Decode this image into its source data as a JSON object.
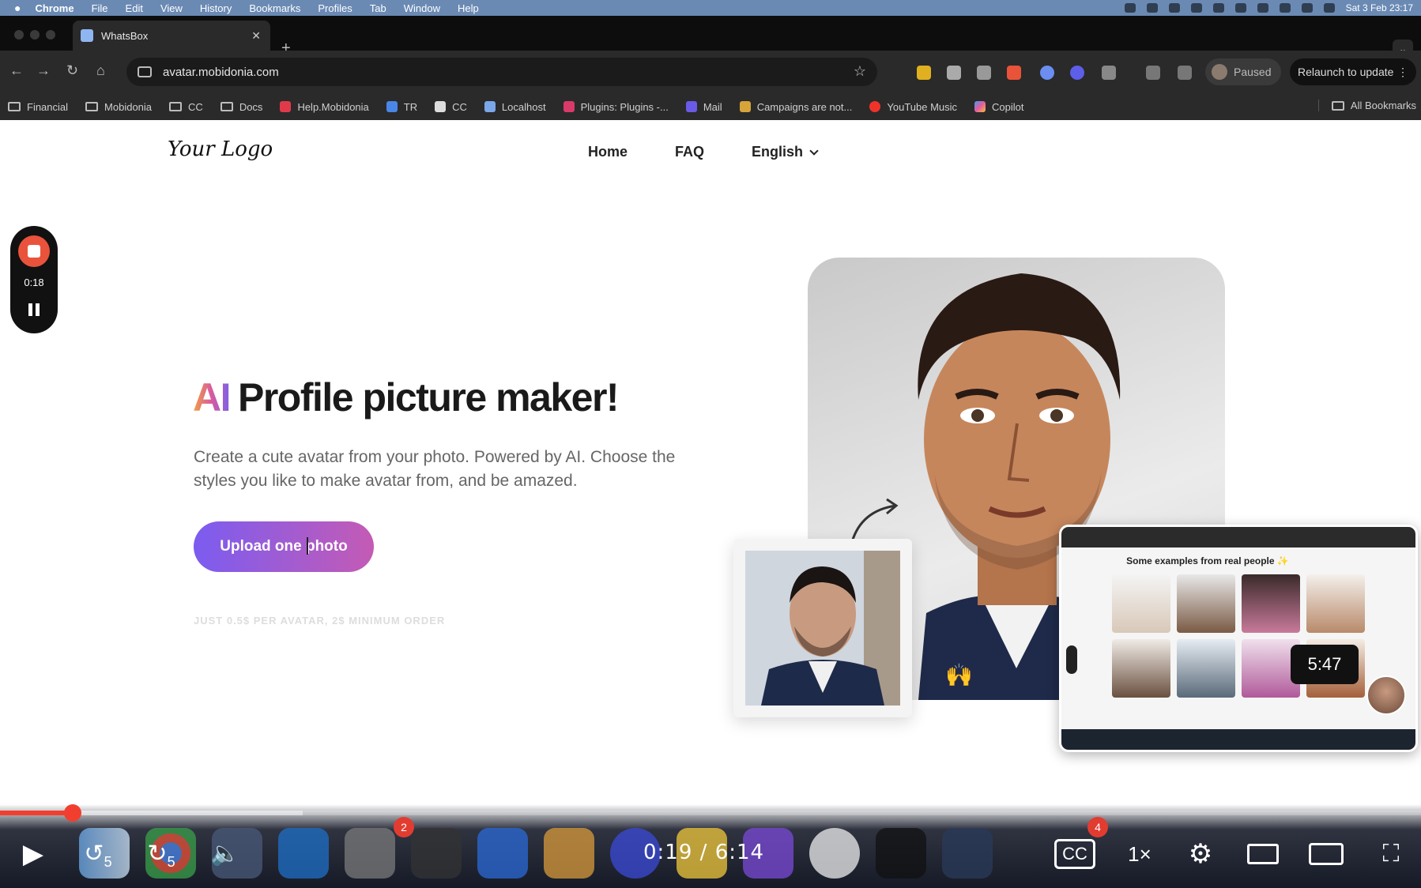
{
  "menubar": {
    "app": "Chrome",
    "items": [
      "File",
      "Edit",
      "View",
      "History",
      "Bookmarks",
      "Profiles",
      "Tab",
      "Window",
      "Help"
    ],
    "clock": "Sat 3 Feb  23:17"
  },
  "browser": {
    "tab_title": "WhatsBox",
    "url": "avatar.mobidonia.com",
    "paused_label": "Paused",
    "relaunch_label": "Relaunch to update",
    "bookmarks": [
      "Financial",
      "Mobidonia",
      "CC",
      "Docs",
      "Help.Mobidonia",
      "TR",
      "CC",
      "Localhost",
      "Plugins: Plugins -...",
      "Mail",
      "Campaigns are not...",
      "YouTube Music",
      "Copilot"
    ],
    "all_bookmarks": "All Bookmarks"
  },
  "site": {
    "logo": "Your Logo",
    "nav": {
      "home": "Home",
      "faq": "FAQ",
      "language": "English"
    },
    "recorder_time": "0:18",
    "hero_ai": "AI",
    "hero_title": "Profile picture maker!",
    "hero_subtitle": "Create a cute avatar from your photo. Powered by AI. Choose the styles you like to make avatar from, and be amazed.",
    "upload_button": "Upload one photo",
    "pricing_note": "JUST 0.5$ PER AVATAR, 2$ MINIMUM ORDER",
    "pip_heading": "Some examples from real people ✨"
  },
  "player": {
    "current_time": "0:19",
    "separator": "/",
    "duration": "6:14",
    "skip_badge": "5:47",
    "played_fraction": 0.051,
    "buffered_fraction": 0.213,
    "speed": "1×",
    "rewind_seconds": "5",
    "forward_seconds": "5",
    "emoji": "🙌",
    "dock_badges": [
      "2",
      "4"
    ]
  },
  "colors": {
    "accent_gradient_start": "#7b5cf0",
    "accent_gradient_end": "#c45bb5",
    "progress_red": "#f23e2e",
    "recorder_red": "#e9533b"
  }
}
